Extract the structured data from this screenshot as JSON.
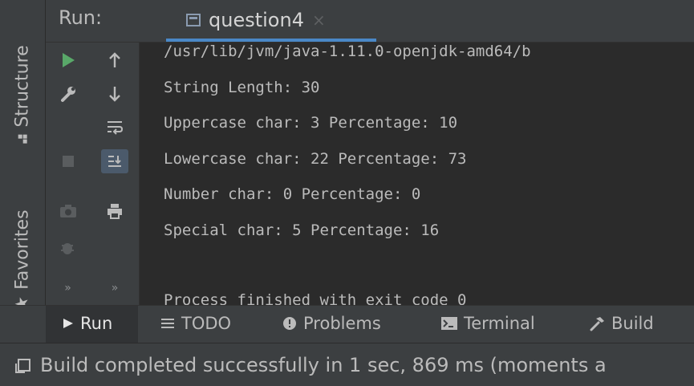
{
  "left_strip": {
    "structure_label": "Structure",
    "favorites_label": "Favorites",
    "favorites_icon": "★"
  },
  "run_header": {
    "label": "Run:",
    "tab_title": "question4",
    "tab_close": "×"
  },
  "toolbar": {
    "col1": [
      "▶",
      "🔧",
      "■",
      "📷",
      "🐞",
      "»"
    ],
    "col2": [
      "↑",
      "↓",
      "⮐",
      "⇊",
      "🖶",
      "»"
    ]
  },
  "console": {
    "lines": [
      "/usr/lib/jvm/java-1.11.0-openjdk-amd64/b",
      "String Length: 30",
      "Uppercase char: 3 Percentage: 10",
      "Lowercase char: 22 Percentage: 73",
      "Number char: 0 Percentage: 0",
      "Special char: 5 Percentage: 16",
      "Process finished with exit code 0"
    ]
  },
  "bottom_tabs": {
    "run": "Run",
    "todo": "TODO",
    "problems": "Problems",
    "terminal": "Terminal",
    "build": "Build"
  },
  "status": {
    "text": "Build completed successfully in 1 sec, 869 ms (moments a"
  },
  "colors": {
    "accent": "#4a88c7",
    "run_green": "#59a869",
    "console_bg": "#2b2b2b",
    "panel_bg": "#3c3f41"
  }
}
